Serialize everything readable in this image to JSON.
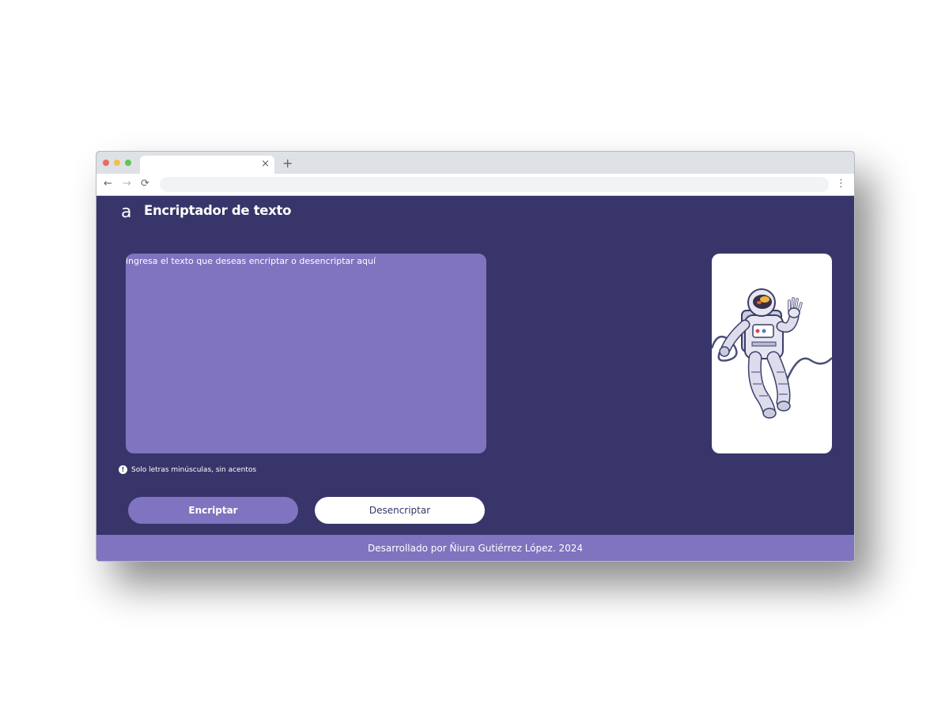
{
  "browser": {
    "tab_close": "×",
    "new_tab": "+",
    "back": "←",
    "forward": "→",
    "reload": "⟳",
    "menu": "⋮"
  },
  "header": {
    "logo": "a",
    "title": "Encriptador de texto"
  },
  "input": {
    "placeholder": "ingresa el texto que deseas encriptar o desencriptar aquí"
  },
  "hint": {
    "icon": "!",
    "text": "Solo letras minúsculas, sin acentos"
  },
  "buttons": {
    "encrypt": "Encriptar",
    "decrypt": "Desencriptar"
  },
  "footer": {
    "text": "Desarrollado por Ñiura Gutiérrez López. 2024"
  },
  "colors": {
    "background": "#37356a",
    "accent": "#8073bf",
    "white": "#ffffff"
  },
  "icons": {
    "illustration": "astronaut-illustration"
  }
}
